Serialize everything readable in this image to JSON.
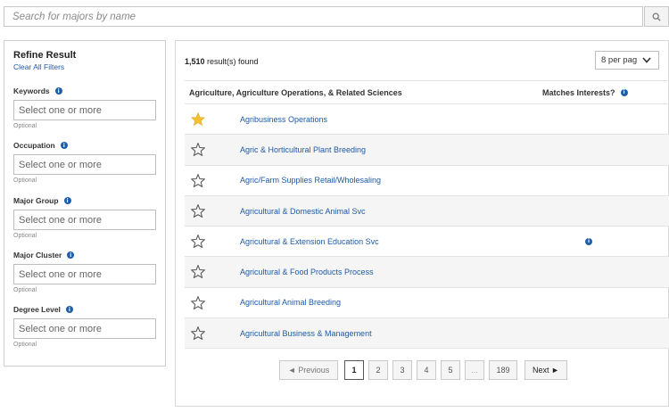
{
  "search": {
    "placeholder": "Search for majors by name"
  },
  "refine": {
    "title": "Refine Result",
    "clear_label": "Clear All Filters",
    "filters": [
      {
        "label": "Keywords",
        "placeholder": "Select one or more",
        "hint": "Optional"
      },
      {
        "label": "Occupation",
        "placeholder": "Select one or more",
        "hint": "Optional"
      },
      {
        "label": "Major Group",
        "placeholder": "Select one or more",
        "hint": "Optional"
      },
      {
        "label": "Major Cluster",
        "placeholder": "Select one or more",
        "hint": "Optional"
      },
      {
        "label": "Degree Level",
        "placeholder": "Select one or more",
        "hint": "Optional"
      }
    ]
  },
  "results": {
    "count": "1,510",
    "count_suffix": " result(s) found",
    "per_page": "8 per pag",
    "group_header": "Agriculture, Agriculture Operations, & Related Sciences",
    "match_header": "Matches Interests?",
    "rows": [
      {
        "name": "Agribusiness Operations",
        "starred": true,
        "match_info": false
      },
      {
        "name": "Agric & Horticultural Plant Breeding",
        "starred": false,
        "match_info": false
      },
      {
        "name": "Agric/Farm Supplies Retail/Wholesaling",
        "starred": false,
        "match_info": false
      },
      {
        "name": "Agricultural & Domestic Animal Svc",
        "starred": false,
        "match_info": false
      },
      {
        "name": "Agricultural & Extension Education Svc",
        "starred": false,
        "match_info": true
      },
      {
        "name": "Agricultural & Food Products Process",
        "starred": false,
        "match_info": false
      },
      {
        "name": "Agricultural Animal Breeding",
        "starred": false,
        "match_info": false
      },
      {
        "name": "Agricultural Business & Management",
        "starred": false,
        "match_info": false
      }
    ]
  },
  "pagination": {
    "prev": "◄ Previous",
    "pages": [
      "1",
      "2",
      "3",
      "4",
      "5"
    ],
    "ellipsis": "...",
    "last": "189",
    "next": "Next ►",
    "current": "1"
  },
  "colors": {
    "link": "#1e5aa8",
    "star_filled": "#f2c232",
    "info": "#1f5ea8"
  },
  "icons": {
    "search": "search-icon",
    "star": "star-icon",
    "info": "info-icon",
    "chevron": "chevron-down-icon"
  }
}
